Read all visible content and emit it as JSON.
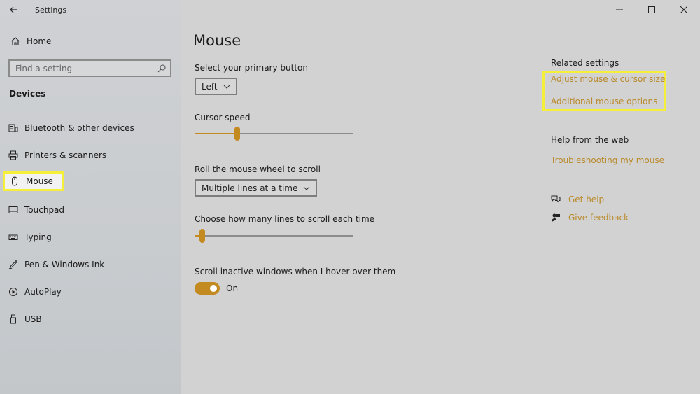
{
  "window": {
    "title": "Settings"
  },
  "sidebar": {
    "home_label": "Home",
    "search_placeholder": "Find a setting",
    "section_title": "Devices",
    "items": [
      {
        "label": "Bluetooth & other devices",
        "icon": "bluetooth-devices-icon"
      },
      {
        "label": "Printers & scanners",
        "icon": "printer-icon"
      },
      {
        "label": "Mouse",
        "icon": "mouse-icon",
        "selected": true
      },
      {
        "label": "Touchpad",
        "icon": "touchpad-icon"
      },
      {
        "label": "Typing",
        "icon": "keyboard-icon"
      },
      {
        "label": "Pen & Windows Ink",
        "icon": "pen-icon"
      },
      {
        "label": "AutoPlay",
        "icon": "autoplay-icon"
      },
      {
        "label": "USB",
        "icon": "usb-icon"
      }
    ]
  },
  "main": {
    "title": "Mouse",
    "primary_button": {
      "label": "Select your primary button",
      "value": "Left"
    },
    "cursor_speed": {
      "label": "Cursor speed",
      "value_fraction": 0.27
    },
    "scroll_wheel": {
      "label": "Roll the mouse wheel to scroll",
      "value": "Multiple lines at a time"
    },
    "scroll_lines": {
      "label": "Choose how many lines to scroll each time",
      "value_fraction": 0.05
    },
    "scroll_inactive": {
      "label": "Scroll inactive windows when I hover over them",
      "state": "On",
      "enabled": true
    }
  },
  "related": {
    "title": "Related settings",
    "links": [
      "Adjust mouse & cursor size",
      "Additional mouse options"
    ]
  },
  "help": {
    "title": "Help from the web",
    "troubleshoot": "Troubleshooting my mouse",
    "get_help": "Get help",
    "give_feedback": "Give feedback"
  },
  "colors": {
    "accent": "#c28a1f",
    "highlight": "#f5ef3a",
    "link": "#b98a2a"
  }
}
